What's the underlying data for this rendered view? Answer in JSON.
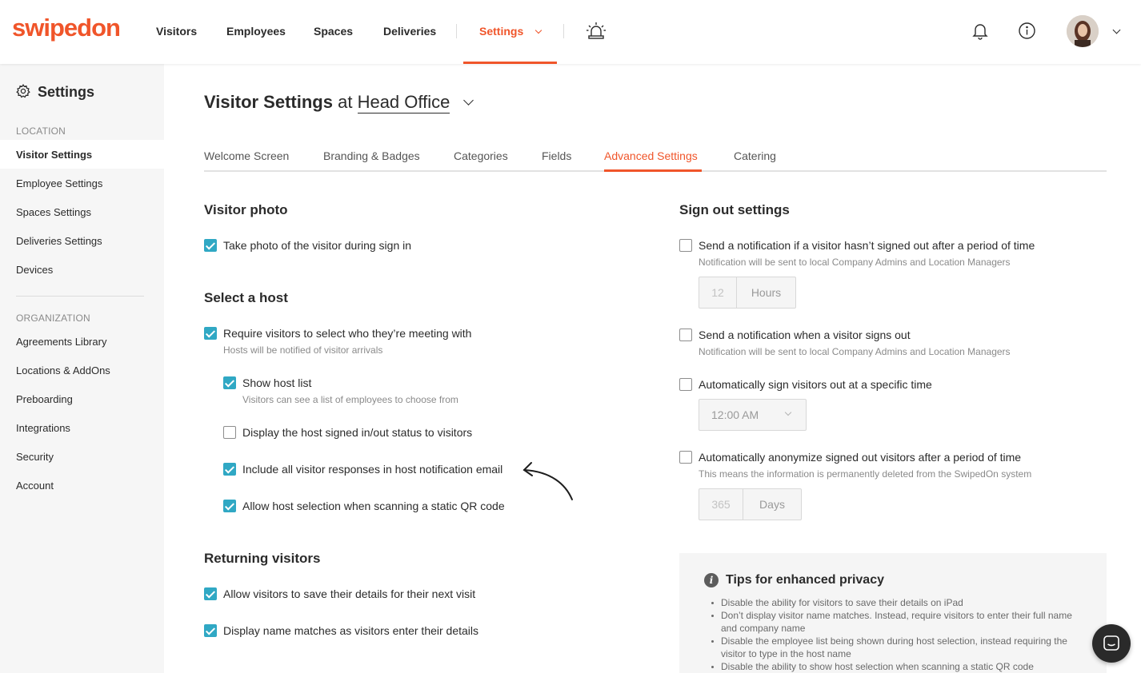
{
  "brand": {
    "logo_text": "swipedon",
    "accent": "#f0552a",
    "checkbox_color": "#30a8c4"
  },
  "nav": {
    "visitors": "Visitors",
    "employees": "Employees",
    "spaces": "Spaces",
    "deliveries": "Deliveries",
    "settings": "Settings",
    "icons": [
      "alarm-icon",
      "bell-icon",
      "info-icon",
      "avatar",
      "chevron-down-icon"
    ]
  },
  "sidebar": {
    "title": "Settings",
    "location_heading": "LOCATION",
    "location_items": [
      "Visitor Settings",
      "Employee Settings",
      "Spaces Settings",
      "Deliveries Settings",
      "Devices"
    ],
    "organization_heading": "ORGANIZATION",
    "organization_items": [
      "Agreements Library",
      "Locations & AddOns",
      "Preboarding",
      "Integrations",
      "Security",
      "Account"
    ]
  },
  "page": {
    "title": "Visitor Settings",
    "at": "at",
    "location": "Head Office"
  },
  "tabs": [
    "Welcome Screen",
    "Branding & Badges",
    "Categories",
    "Fields",
    "Advanced Settings",
    "Catering"
  ],
  "visitor_photo": {
    "title": "Visitor photo",
    "take_photo": {
      "label": "Take photo of the visitor during sign in",
      "checked": true
    }
  },
  "select_host": {
    "title": "Select a host",
    "require": {
      "label": "Require visitors to select who they’re meeting with",
      "hint": "Hosts will be notified of visitor arrivals",
      "checked": true
    },
    "show_list": {
      "label": "Show host list",
      "hint": "Visitors can see a list of employees to choose from",
      "checked": true
    },
    "display_status": {
      "label": "Display the host signed in/out status to visitors",
      "checked": false
    },
    "include_responses": {
      "label": "Include all visitor responses in host notification email",
      "checked": true
    },
    "allow_qr": {
      "label": "Allow host selection when scanning a static QR code",
      "checked": true
    }
  },
  "returning": {
    "title": "Returning visitors",
    "save_details": {
      "label": "Allow visitors to save their details for their next visit",
      "checked": true
    },
    "name_matches": {
      "label": "Display name matches as visitors enter their details",
      "checked": true
    }
  },
  "sign_out": {
    "title": "Sign out settings",
    "notify_period": {
      "label": "Send a notification if a visitor hasn’t signed out after a period of time",
      "hint": "Notification will be sent to local Company Admins and Location Managers",
      "checked": false,
      "value": "12",
      "unit": "Hours"
    },
    "notify_signout": {
      "label": "Send a notification when a visitor signs out",
      "hint": "Notification will be sent to local Company Admins and Location Managers",
      "checked": false
    },
    "auto_signout": {
      "label": "Automatically sign visitors out at a specific time",
      "checked": false,
      "time": "12:00 AM"
    },
    "anonymize": {
      "label": "Automatically anonymize signed out visitors after a period of time",
      "hint": "This means the information is permanently deleted from the SwipedOn system",
      "checked": false,
      "value": "365",
      "unit": "Days"
    }
  },
  "tips": {
    "title": "Tips for enhanced privacy",
    "items": [
      "Disable the ability for visitors to save their details on iPad",
      "Don’t display visitor name matches. Instead, require visitors to enter their full name and company name",
      "Disable the employee list being shown during host selection, instead requiring the visitor to type in the host name",
      "Disable the ability to show host selection when scanning a static QR code"
    ]
  }
}
